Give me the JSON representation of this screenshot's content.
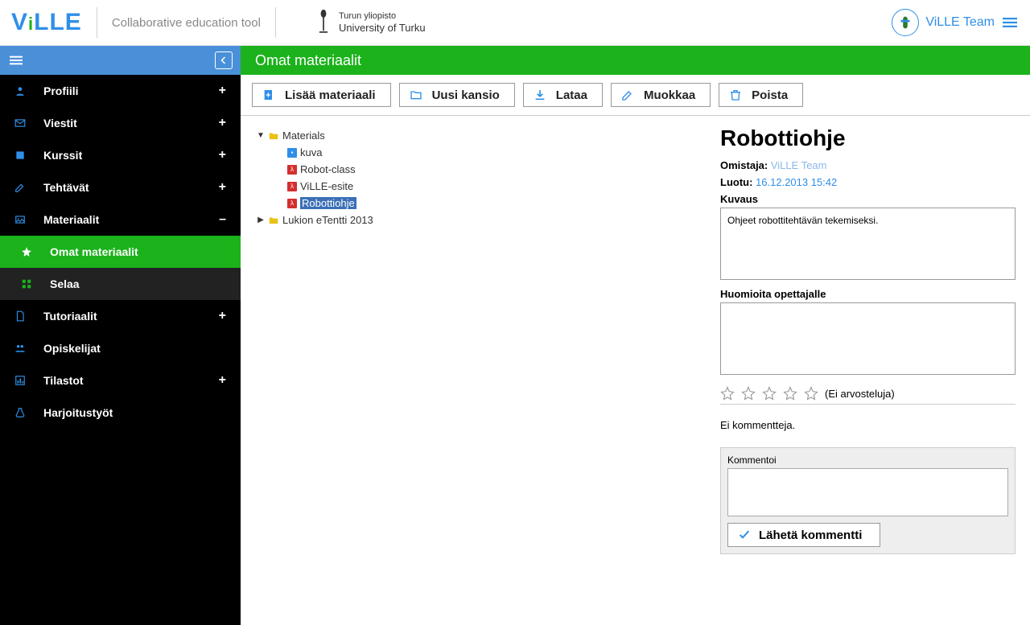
{
  "header": {
    "logo_text": "ViLLE",
    "tagline": "Collaborative education tool",
    "university_line1": "Turun yliopisto",
    "university_line2": "University of Turku",
    "team_name": "ViLLE Team"
  },
  "sidebar": {
    "items": [
      {
        "label": "Profiili",
        "expandable": "plus"
      },
      {
        "label": "Viestit",
        "expandable": "plus"
      },
      {
        "label": "Kurssit",
        "expandable": "plus"
      },
      {
        "label": "Tehtävät",
        "expandable": "plus"
      },
      {
        "label": "Materiaalit",
        "expandable": "minus"
      },
      {
        "label": "Tutoriaalit",
        "expandable": "plus"
      },
      {
        "label": "Opiskelijat",
        "expandable": ""
      },
      {
        "label": "Tilastot",
        "expandable": "plus"
      },
      {
        "label": "Harjoitustyöt",
        "expandable": ""
      }
    ],
    "sub_materiaalit": [
      {
        "label": "Omat materiaalit",
        "active": true
      },
      {
        "label": "Selaa",
        "active": false
      }
    ]
  },
  "page_title": "Omat materiaalit",
  "toolbar": {
    "add": "Lisää materiaali",
    "newfolder": "Uusi kansio",
    "download": "Lataa",
    "edit": "Muokkaa",
    "delete": "Poista"
  },
  "tree": {
    "root_label": "Materials",
    "files": [
      {
        "name": "kuva",
        "type": "img"
      },
      {
        "name": "Robot-class",
        "type": "pdf"
      },
      {
        "name": "ViLLE-esite",
        "type": "pdf"
      },
      {
        "name": "Robottiohje",
        "type": "pdf",
        "selected": true
      }
    ],
    "folder2": "Lukion eTentti 2013"
  },
  "detail": {
    "title": "Robottiohje",
    "owner_label": "Omistaja:",
    "owner_value": "ViLLE Team",
    "created_label": "Luotu:",
    "created_value": "16.12.2013 15:42",
    "desc_label": "Kuvaus",
    "desc_value": "Ohjeet robottitehtävän tekemiseksi.",
    "notes_label": "Huomioita opettajalle",
    "no_ratings": "(Ei arvosteluja)",
    "no_comments": "Ei kommentteja.",
    "comment_label": "Kommentoi",
    "comment_button": "Lähetä kommentti"
  }
}
